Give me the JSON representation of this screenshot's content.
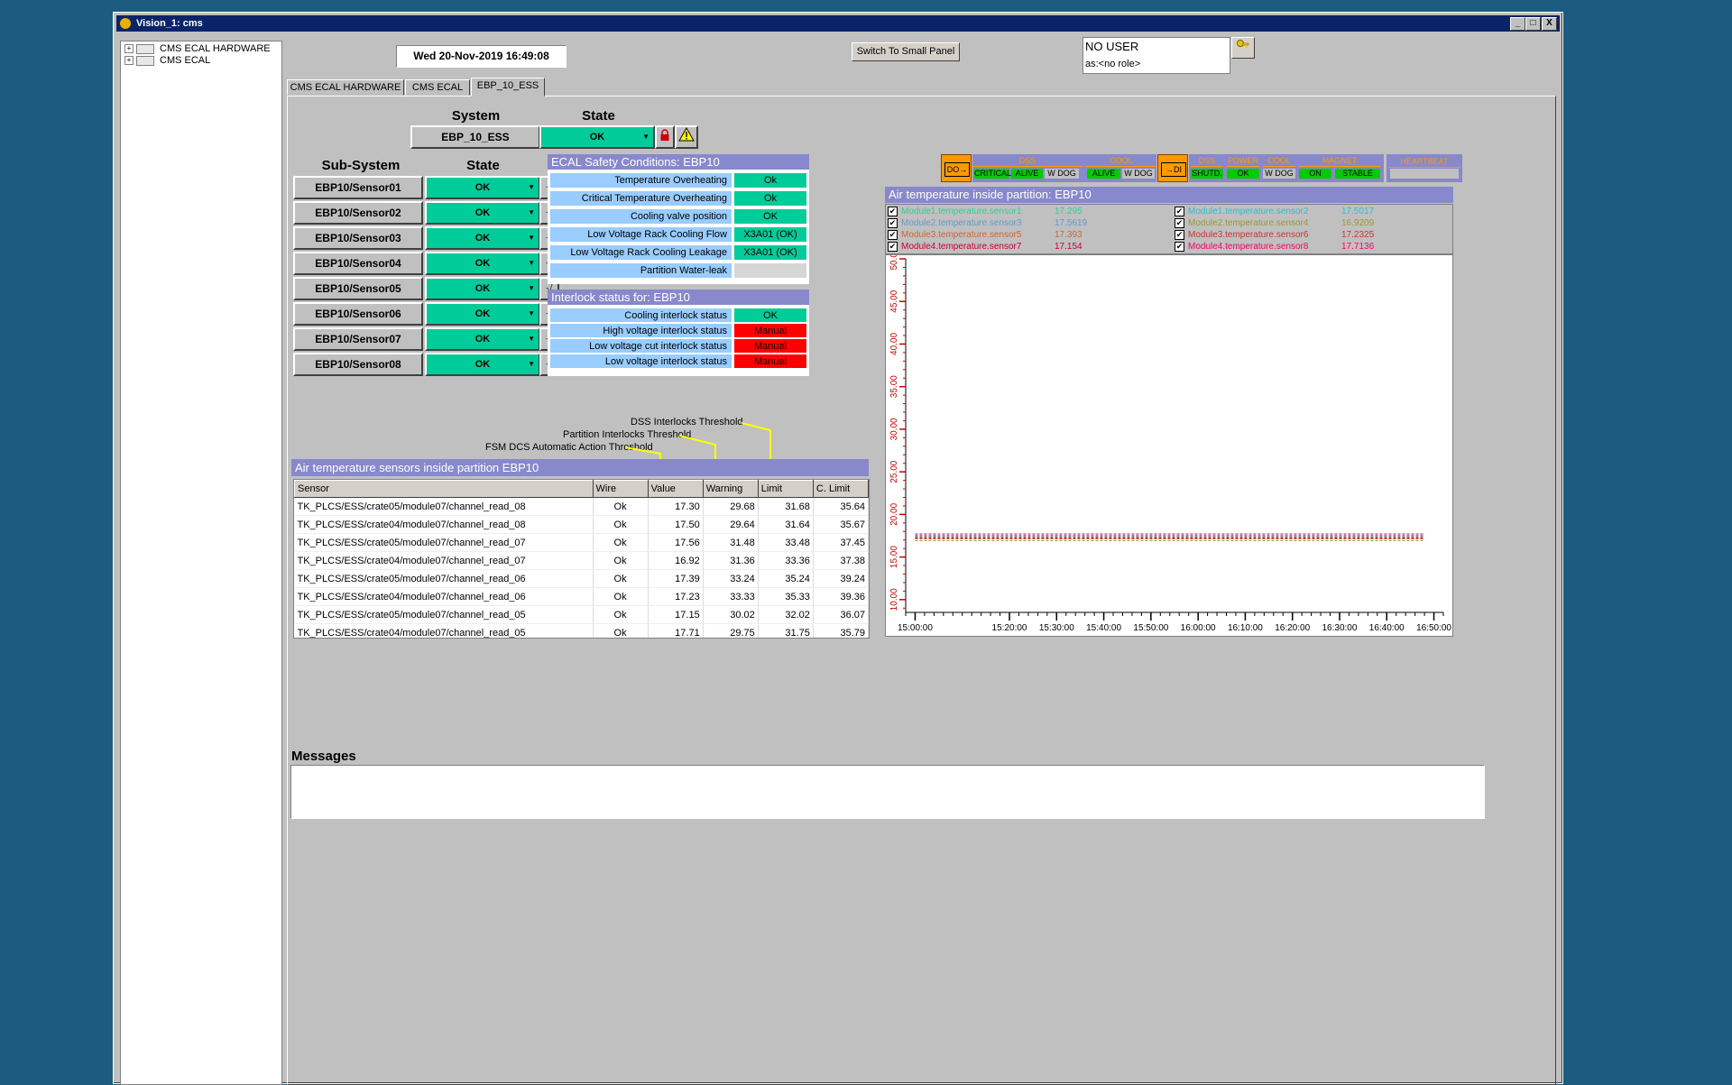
{
  "window": {
    "title": "Vision_1: cms",
    "btn_min": "_",
    "btn_max": "□",
    "btn_close": "X"
  },
  "tree": {
    "items": [
      {
        "label": "CMS ECAL HARDWARE",
        "expand": "+"
      },
      {
        "label": "CMS ECAL",
        "expand": "+"
      }
    ]
  },
  "datetime": "Wed  20-Nov-2019     16:49:08",
  "switch_button": "Switch To Small Panel",
  "user": {
    "name": "NO USER",
    "role": "as:<no role>"
  },
  "tabs": [
    {
      "label": "CMS ECAL HARDWARE"
    },
    {
      "label": "CMS ECAL"
    },
    {
      "label": "EBP_10_ESS"
    }
  ],
  "system": {
    "header_system": "System",
    "header_state": "State",
    "name": "EBP_10_ESS",
    "state": "OK"
  },
  "subsystem": {
    "header_name": "Sub-System",
    "header_state": "State",
    "check_glyph": "√",
    "rows": [
      {
        "name": "EBP10/Sensor01",
        "state": "OK"
      },
      {
        "name": "EBP10/Sensor02",
        "state": "OK"
      },
      {
        "name": "EBP10/Sensor03",
        "state": "OK"
      },
      {
        "name": "EBP10/Sensor04",
        "state": "OK"
      },
      {
        "name": "EBP10/Sensor05",
        "state": "OK"
      },
      {
        "name": "EBP10/Sensor06",
        "state": "OK"
      },
      {
        "name": "EBP10/Sensor07",
        "state": "OK"
      },
      {
        "name": "EBP10/Sensor08",
        "state": "OK"
      }
    ]
  },
  "safety": {
    "title": "ECAL Safety Conditions: EBP10",
    "rows": [
      {
        "label": "Temperature Overheating",
        "value": "Ok",
        "status": "ok"
      },
      {
        "label": "Critical Temperature Overheating",
        "value": "Ok",
        "status": "ok"
      },
      {
        "label": "Cooling valve position",
        "value": "OK",
        "status": "ok"
      },
      {
        "label": "Low Voltage Rack Cooling Flow",
        "value": "X3A01 (OK)",
        "status": "ok"
      },
      {
        "label": "Low Voltage Rack Cooling Leakage",
        "value": "X3A01 (OK)",
        "status": "ok"
      },
      {
        "label": "Partition Water-leak",
        "value": "",
        "status": "none"
      }
    ]
  },
  "interlock": {
    "title": "Interlock status for: EBP10",
    "rows": [
      {
        "label": "Cooling interlock status",
        "value": "OK",
        "status": "ok"
      },
      {
        "label": "High voltage interlock status",
        "value": "Manual",
        "status": "alarm"
      },
      {
        "label": "Low voltage cut interlock status",
        "value": "Manual",
        "status": "alarm"
      },
      {
        "label": "Low voltage interlock status",
        "value": "Manual",
        "status": "alarm"
      }
    ]
  },
  "thresholds": {
    "dss": "DSS Interlocks Threshold",
    "partition": "Partition Interlocks Threshold",
    "fsm": "FSM DCS Automatic Action Threshold"
  },
  "sensors": {
    "title": "Air temperature sensors inside partition EBP10",
    "columns": [
      "Sensor",
      "Wire",
      "Value",
      "Warning",
      "Limit",
      "C. Limit"
    ],
    "rows": [
      [
        "TK_PLCS/ESS/crate05/module07/channel_read_08",
        "Ok",
        "17.30",
        "29.68",
        "31.68",
        "35.64"
      ],
      [
        "TK_PLCS/ESS/crate04/module07/channel_read_08",
        "Ok",
        "17.50",
        "29.64",
        "31.64",
        "35.67"
      ],
      [
        "TK_PLCS/ESS/crate05/module07/channel_read_07",
        "Ok",
        "17.56",
        "31.48",
        "33.48",
        "37.45"
      ],
      [
        "TK_PLCS/ESS/crate04/module07/channel_read_07",
        "Ok",
        "16.92",
        "31.36",
        "33.36",
        "37.38"
      ],
      [
        "TK_PLCS/ESS/crate05/module07/channel_read_06",
        "Ok",
        "17.39",
        "33.24",
        "35.24",
        "39.24"
      ],
      [
        "TK_PLCS/ESS/crate04/module07/channel_read_06",
        "Ok",
        "17.23",
        "33.33",
        "35.33",
        "39.36"
      ],
      [
        "TK_PLCS/ESS/crate05/module07/channel_read_05",
        "Ok",
        "17.15",
        "30.02",
        "32.02",
        "36.07"
      ],
      [
        "TK_PLCS/ESS/crate04/module07/channel_read_05",
        "Ok",
        "17.71",
        "29.75",
        "31.75",
        "35.79"
      ]
    ]
  },
  "fsm": {
    "do_label": "DO",
    "di_label": "DI",
    "arrow": "→",
    "do_groups": [
      {
        "title": "DSS",
        "cells": [
          {
            "text": "CRITICAL",
            "color": "#00cc00"
          },
          {
            "text": "ALIVE",
            "color": "#00cc00"
          },
          {
            "text": "W DOG",
            "color": "#c0c0c0"
          }
        ]
      },
      {
        "title": "COOL",
        "cells": [
          {
            "text": "ALIVE",
            "color": "#00cc00"
          },
          {
            "text": "W DOG",
            "color": "#c0c0c0"
          }
        ]
      }
    ],
    "di_groups": [
      {
        "title": "DSS",
        "cells": [
          {
            "text": "SHUTD.",
            "color": "#00cc00"
          }
        ]
      },
      {
        "title": "POWER",
        "cells": [
          {
            "text": "OK",
            "color": "#00cc00"
          }
        ]
      },
      {
        "title": "COOL",
        "cells": [
          {
            "text": "W DOG",
            "color": "#c0c0c0"
          }
        ]
      },
      {
        "title": "MAGNET",
        "cells": [
          {
            "text": "ON",
            "color": "#00cc00"
          },
          {
            "text": "STABLE",
            "color": "#00cc00"
          }
        ]
      }
    ],
    "heartbeat": "HEARTBEAT"
  },
  "plot_title": "Air temperature inside partition: EBP10",
  "legend": [
    {
      "label": "Module1.temperature.sensor1",
      "value": "17.295",
      "color": "#33cc99",
      "check": "✔"
    },
    {
      "label": "Module1.temperature.sensor2",
      "value": "17.5017",
      "color": "#33bbcc",
      "check": "✔"
    },
    {
      "label": "Module2.temperature.sensor3",
      "value": "17.5619",
      "color": "#6699cc",
      "check": "✔"
    },
    {
      "label": "Module2.temperature.sensor4",
      "value": "16.9209",
      "color": "#999933",
      "check": "✔"
    },
    {
      "label": "Module3.temperature.sensor5",
      "value": "17.393",
      "color": "#cc6633",
      "check": "✔"
    },
    {
      "label": "Module3.temperature.sensor6",
      "value": "17.2325",
      "color": "#cc3333",
      "check": "✔"
    },
    {
      "label": "Module4.temperature.sensor7",
      "value": "17.154",
      "color": "#cc0033",
      "check": "✔"
    },
    {
      "label": "Module4.temperature.sensor8",
      "value": "17.7136",
      "color": "#ff0066",
      "check": "✔"
    }
  ],
  "chart_data": {
    "type": "line",
    "title": "",
    "y_ticks": [
      "10.00",
      "15.00",
      "20.00",
      "25.00",
      "30.00",
      "35.00",
      "40.00",
      "45.00",
      "50.00"
    ],
    "ylim": [
      8.5,
      50
    ],
    "x_ticks": [
      "15:00:00",
      "15:20:00",
      "15:30:00",
      "15:40:00",
      "15:50:00",
      "16:00:00",
      "16:10:00",
      "16:20:00",
      "16:30:00",
      "16:40:00",
      "16:50:00"
    ],
    "xlim": [
      "14:58:00",
      "16:52:00"
    ],
    "series": [
      {
        "name": "Module1.temperature.sensor1",
        "color": "#33cc99",
        "y": 17.295,
        "x_start": "15:00:00",
        "x_end": "16:48:00"
      },
      {
        "name": "Module1.temperature.sensor2",
        "color": "#33bbcc",
        "y": 17.5017,
        "x_start": "15:00:00",
        "x_end": "16:48:00"
      },
      {
        "name": "Module2.temperature.sensor3",
        "color": "#6699cc",
        "y": 17.5619,
        "x_start": "15:00:00",
        "x_end": "16:48:00"
      },
      {
        "name": "Module2.temperature.sensor4",
        "color": "#999933",
        "y": 16.9209,
        "x_start": "15:00:00",
        "x_end": "16:48:00"
      },
      {
        "name": "Module3.temperature.sensor5",
        "color": "#cc6633",
        "y": 17.393,
        "x_start": "15:00:00",
        "x_end": "16:48:00"
      },
      {
        "name": "Module3.temperature.sensor6",
        "color": "#cc3333",
        "y": 17.2325,
        "x_start": "15:00:00",
        "x_end": "16:48:00"
      },
      {
        "name": "Module4.temperature.sensor7",
        "color": "#cc0033",
        "y": 17.154,
        "x_start": "15:00:00",
        "x_end": "16:48:00"
      },
      {
        "name": "Module4.temperature.sensor8",
        "color": "#ff0066",
        "y": 17.7136,
        "x_start": "15:00:00",
        "x_end": "16:48:00"
      }
    ]
  },
  "messages": {
    "title": "Messages"
  }
}
